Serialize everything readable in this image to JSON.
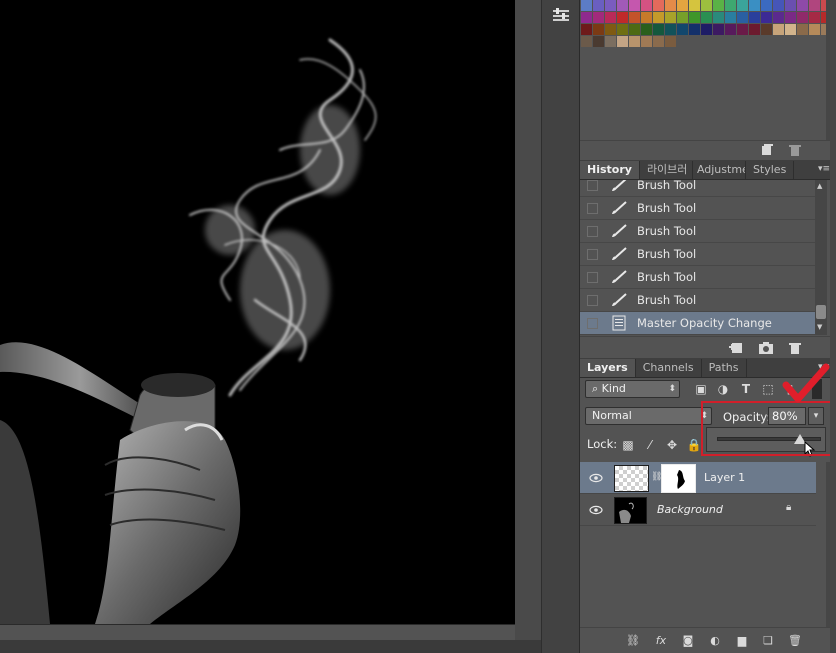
{
  "swatches": {
    "rows": [
      [
        "#5c7cc6",
        "#6a5fc1",
        "#7a5cbf",
        "#a15ab8",
        "#c557ae",
        "#d45282",
        "#e36a5c",
        "#e48b49",
        "#e3a540",
        "#d5c43e",
        "#9dbf3f",
        "#5ab246",
        "#3ea870",
        "#3ba49b",
        "#3a8fc3",
        "#3b6ac0",
        "#4656b8",
        "#6a4fb0",
        "#8e4aa8",
        "#b0457e",
        "#cc4a4e"
      ],
      [
        "#8f2a8e",
        "#a22a7c",
        "#b92a58",
        "#c02a2a",
        "#c3532a",
        "#c67a2a",
        "#c49a2a",
        "#a8a32a",
        "#77a02a",
        "#3f962a",
        "#2a8f52",
        "#2a8a7c",
        "#2a7ea0",
        "#2a5fa2",
        "#2a3f9c",
        "#3c2a95",
        "#5b2a8e",
        "#7a2a86",
        "#8f2a6a",
        "#a52a45",
        "#b52a2a"
      ],
      [
        "#6e1a1a",
        "#7b3a14",
        "#7f5a12",
        "#6f6f12",
        "#4d6a14",
        "#2a5f1c",
        "#14583d",
        "#12525a",
        "#12476d",
        "#13306a",
        "#1e1c66",
        "#3c1a62",
        "#571a5c",
        "#6a1a48",
        "#6c1a2e",
        "#5a3a2a",
        "#c7a47a",
        "#d2b48c",
        "#8a6a4a",
        "#b58a5a",
        "#9a7a5a"
      ],
      [
        "#6b5a4a",
        "#4a3a30",
        "#7b6e60",
        "#c4a585",
        "#b8946c",
        "#a07a55",
        "#8a6b4d",
        "#7a5c3f"
      ]
    ]
  },
  "history_panel": {
    "tabs": [
      "History",
      "라이브러",
      "Adjustme",
      "Styles"
    ],
    "active_tab": "History",
    "items": [
      {
        "label": "Brush Tool",
        "icon": "brush-icon",
        "selected": false
      },
      {
        "label": "Brush Tool",
        "icon": "brush-icon",
        "selected": false
      },
      {
        "label": "Brush Tool",
        "icon": "brush-icon",
        "selected": false
      },
      {
        "label": "Brush Tool",
        "icon": "brush-icon",
        "selected": false
      },
      {
        "label": "Brush Tool",
        "icon": "brush-icon",
        "selected": false
      },
      {
        "label": "Brush Tool",
        "icon": "brush-icon",
        "selected": false
      },
      {
        "label": "Master Opacity Change",
        "icon": "document-icon",
        "selected": true
      }
    ]
  },
  "layers_panel": {
    "tabs": [
      "Layers",
      "Channels",
      "Paths"
    ],
    "active_tab": "Layers",
    "filter_kind": "Kind",
    "blend_mode": "Normal",
    "opacity_label": "Opacity:",
    "opacity_value": "80%",
    "opacity_level": 0.8,
    "lock_label": "Lock:",
    "layers": [
      {
        "name": "Layer 1",
        "selected": true,
        "visible": true,
        "has_mask": true,
        "locked": false
      },
      {
        "name": "Background",
        "selected": false,
        "visible": true,
        "has_mask": false,
        "locked": true
      }
    ]
  },
  "colors": {
    "panel_bg": "#535353",
    "selection": "#6c7a8c",
    "highlight_box": "#d11f2a",
    "checkmark": "#e01e2b"
  }
}
